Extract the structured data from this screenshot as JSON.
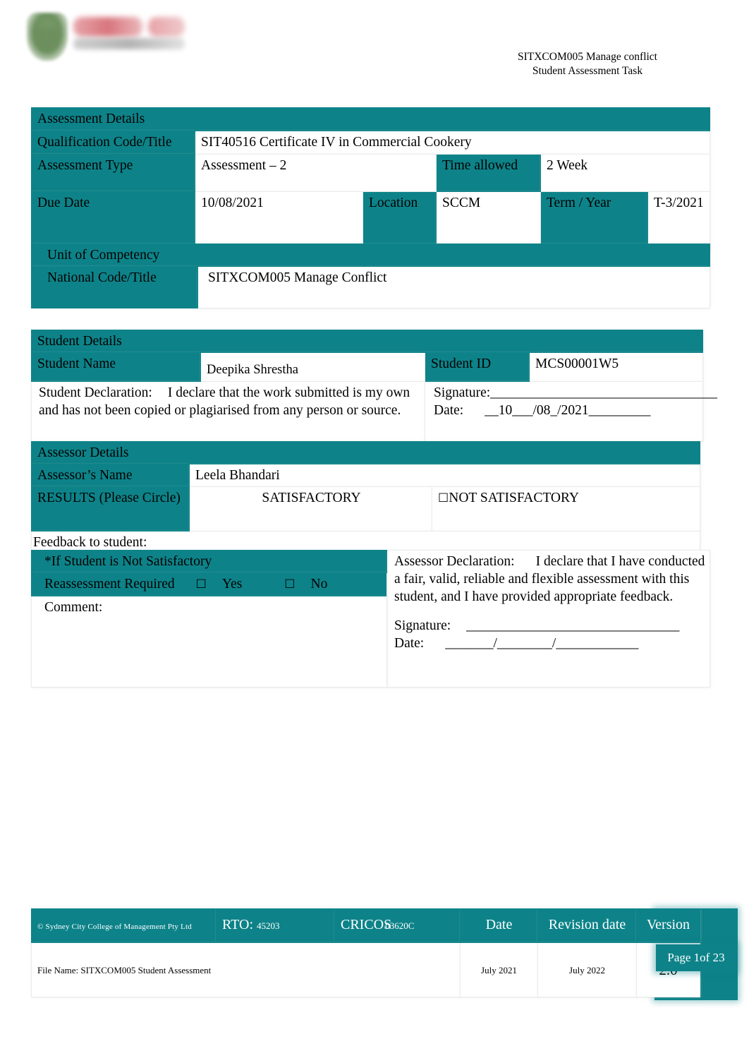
{
  "header": {
    "line1": "SITXCOM005 Manage conflict",
    "line2": "Student Assessment Task",
    "logo_name": "college-logo"
  },
  "assessment": {
    "section_title": "Assessment Details",
    "qualification_label": "Qualification Code/Title",
    "qualification_value": "SIT40516 Certificate IV in Commercial Cookery",
    "type_label": "Assessment Type",
    "type_value": "Assessment – 2",
    "time_label": "Time allowed",
    "time_value": "2 Week",
    "due_label": "Due Date",
    "due_value": "10/08/2021",
    "location_label": "Location",
    "location_value": "SCCM",
    "term_label": "Term / Year",
    "term_value": "T-3/2021"
  },
  "unit": {
    "title_line1": "Unit of Competency",
    "title_line2": "National Code/Title",
    "value": "SITXCOM005 Manage Conflict"
  },
  "student": {
    "section_title": "Student Details",
    "name_label": "Student Name",
    "name_value": "Deepika Shrestha",
    "id_label": "Student ID",
    "id_value": "MCS00001W5",
    "declaration_label": "Student Declaration:",
    "declaration_text": "I declare that the work submitted is my own and has not been copied or plagiarised from any person or source.",
    "signature_label": "Signature:",
    "signature_line": "_________________________________",
    "date_label": "Date:",
    "date_value": "__10___/08_/2021_________"
  },
  "assessor": {
    "section_title": "Assessor Details",
    "name_label": "Assessor’s Name",
    "name_value": "Leela Bhandari",
    "results_label": "RESULTS (Please Circle)",
    "result_satisfactory": "SATISFACTORY",
    "result_not_satisfactory": "NOT SATISFACTORY",
    "not_satisfactory_checkbox": "☐",
    "feedback_label": "Feedback to student:"
  },
  "reassessment": {
    "heading": "*If Student is Not Satisfactory",
    "required_label": "Reassessment Required",
    "yes_label": "Yes",
    "no_label": "No",
    "checkbox": "☐",
    "comment_label": "Comment:",
    "assessor_declaration_label": "Assessor Declaration:",
    "assessor_declaration_text": "I declare that I have conducted a fair, valid, reliable and flexible assessment with this student, and I have provided appropriate feedback.",
    "signature_label": "Signature:",
    "signature_line": "_______________________________",
    "date_label": "Date:",
    "date_line": "_______/________/____________"
  },
  "footer": {
    "copyright": "© Sydney City College of Management Pty Ltd",
    "rto_label": "RTO:",
    "rto_value": "45203",
    "cricos_label": "CRICOS",
    "cricos_value": "03620C",
    "date_header": "Date",
    "revision_header": "Revision date",
    "version_header": "Version",
    "file_name": "File Name: SITXCOM005 Student Assessment",
    "date_value": "July 2021",
    "revision_value": "July 2022",
    "version_value": "2.0",
    "page_number": "Page 1of 23"
  },
  "colors": {
    "teal": "#0d8389",
    "page_background": "#ffffff",
    "text": "#000000"
  }
}
